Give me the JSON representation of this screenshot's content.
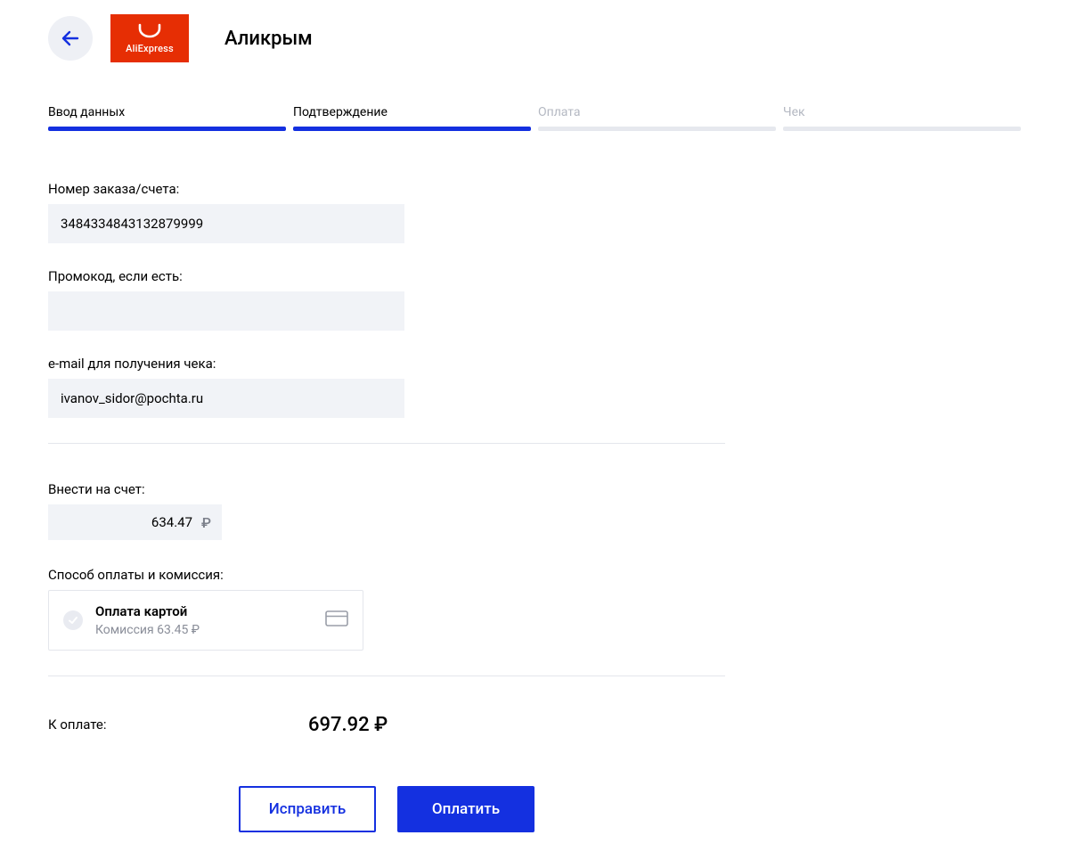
{
  "header": {
    "logo_text": "AliExpress",
    "title": "Аликрым"
  },
  "stepper": {
    "steps": [
      {
        "label": "Ввод данных",
        "active": true
      },
      {
        "label": "Подтверждение",
        "active": true
      },
      {
        "label": "Оплата",
        "active": false
      },
      {
        "label": "Чек",
        "active": false
      }
    ]
  },
  "fields": {
    "order": {
      "label": "Номер заказа/счета:",
      "value": "3484334843132879999"
    },
    "promo": {
      "label": "Промокод, если есть:",
      "value": ""
    },
    "email": {
      "label": "e-mail для получения чека:",
      "value": "ivanov_sidor@pochta.ru"
    }
  },
  "amount": {
    "label": "Внести на счет:",
    "value": "634.47",
    "currency": "₽"
  },
  "payment_method": {
    "section_label": "Способ оплаты и комиссия:",
    "title": "Оплата картой",
    "subtitle": "Комиссия 63.45 ₽"
  },
  "total": {
    "label": "К оплате:",
    "value": "697.92 ₽"
  },
  "buttons": {
    "edit": "Исправить",
    "pay": "Оплатить"
  }
}
